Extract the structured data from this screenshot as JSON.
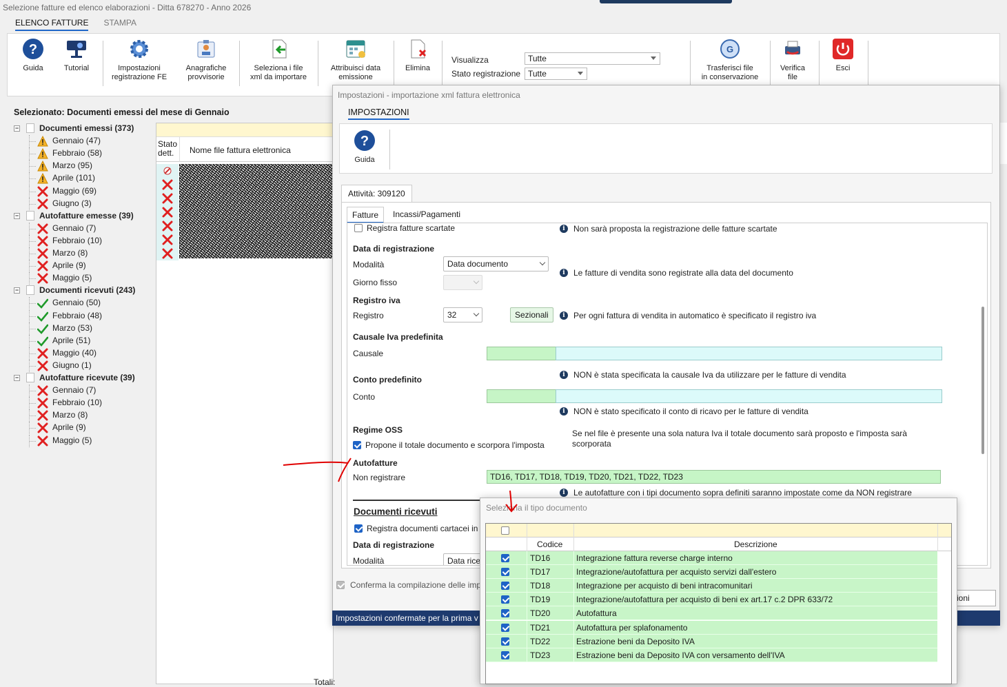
{
  "window": {
    "title": "Selezione fatture ed elenco elaborazioni - Ditta 678270 - Anno 2026"
  },
  "tabs": [
    {
      "label": "ELENCO FATTURE",
      "active": true
    },
    {
      "label": "STAMPA",
      "active": false
    }
  ],
  "ribbon": {
    "guida": "Guida",
    "tutorial": "Tutorial",
    "impostazioni_l1": "Impostazioni",
    "impostazioni_l2": "registrazione FE",
    "anagrafiche_l1": "Anagrafiche",
    "anagrafiche_l2": "provvisorie",
    "seleziona_l1": "Seleziona i file",
    "seleziona_l2": "xml da importare",
    "attribuisci_l1": "Attribuisci data",
    "attribuisci_l2": "emissione",
    "elimina": "Elimina",
    "visualizza_label": "Visualizza",
    "visualizza_value": "Tutte",
    "stato_label": "Stato registrazione",
    "stato_value": "Tutte",
    "trasferisci_l1": "Trasferisci file",
    "trasferisci_l2": "in conservazione",
    "verifica_l1": "Verifica",
    "verifica_l2": "file",
    "esci": "Esci"
  },
  "selected_header": "Selezionato: Documenti emessi del mese di Gennaio",
  "tree": [
    {
      "label": "Documenti emessi (373)",
      "root": true
    },
    {
      "label": "Gennaio (47)",
      "status": "warning"
    },
    {
      "label": "Febbraio (58)",
      "status": "warning"
    },
    {
      "label": "Marzo (95)",
      "status": "warning"
    },
    {
      "label": "Aprile (101)",
      "status": "warning"
    },
    {
      "label": "Maggio (69)",
      "status": "error"
    },
    {
      "label": "Giugno (3)",
      "status": "error"
    },
    {
      "label": "Autofatture emesse (39)",
      "root": true
    },
    {
      "label": "Gennaio (7)",
      "status": "error"
    },
    {
      "label": "Febbraio (10)",
      "status": "error"
    },
    {
      "label": "Marzo (8)",
      "status": "error"
    },
    {
      "label": "Aprile (9)",
      "status": "error"
    },
    {
      "label": "Maggio (5)",
      "status": "error"
    },
    {
      "label": "Documenti ricevuti (243)",
      "root": true
    },
    {
      "label": "Gennaio (50)",
      "status": "ok"
    },
    {
      "label": "Febbraio (48)",
      "status": "ok"
    },
    {
      "label": "Marzo (53)",
      "status": "ok"
    },
    {
      "label": "Aprile (51)",
      "status": "ok"
    },
    {
      "label": "Maggio (40)",
      "status": "error"
    },
    {
      "label": "Giugno (1)",
      "status": "error"
    },
    {
      "label": "Autofatture ricevute (39)",
      "root": true
    },
    {
      "label": "Gennaio (7)",
      "status": "error"
    },
    {
      "label": "Febbraio (10)",
      "status": "error"
    },
    {
      "label": "Marzo (8)",
      "status": "error"
    },
    {
      "label": "Aprile (9)",
      "status": "error"
    },
    {
      "label": "Maggio (5)",
      "status": "error"
    }
  ],
  "grid": {
    "col_stato_l1": "Stato",
    "col_stato_l2": "dett.",
    "col_nome": "Nome file fattura elettronica",
    "totali": "Totali:"
  },
  "dialog": {
    "title": "Impostazioni - importazione xml fattura elettronica",
    "tab": "IMPOSTAZIONI",
    "guida": "Guida",
    "attivita": "Attività: 309120",
    "inner_tabs": [
      "Fatture",
      "Incassi/Pagamenti"
    ],
    "registra_scartate": "Registra fatture scartate",
    "info_scartate": "Non sarà proposta la registrazione delle fatture scartate",
    "data_reg_header": "Data di registrazione",
    "modalita_label": "Modalità",
    "modalita_value": "Data documento",
    "info_modalita": "Le fatture di vendita sono registrate alla data del documento",
    "giorno_fisso_label": "Giorno fisso",
    "registro_iva_header": "Registro iva",
    "registro_label": "Registro",
    "registro_value": "32",
    "sezionali_button": "Sezionali",
    "info_registro": "Per ogni fattura di vendita in automatico è specificato il registro iva",
    "causale_header": "Causale Iva predefinita",
    "causale_label": "Causale",
    "info_causale": "NON è stata specificata la causale Iva da utilizzare per le fatture di vendita",
    "conto_header": "Conto predefinito",
    "conto_label": "Conto",
    "info_conto": "NON è stato specificato il conto di ricavo per le fatture di vendita",
    "oss_header": "Regime OSS",
    "oss_check": "Propone il totale documento e scorpora l'imposta",
    "info_oss_l1": "Se nel file è presente una sola natura Iva il totale documento sarà proposto e l'imposta sarà",
    "info_oss_l2": "scorporata",
    "autofatture_header": "Autofatture",
    "non_registrare_label": "Non registrare",
    "non_registrare_value": "TD16, TD17, TD18, TD19, TD20, TD21, TD22, TD23",
    "info_autofatture": "Le autofatture con i tipi documento sopra definiti saranno impostate come da NON registrare",
    "doc_ricevuti_header": "Documenti ricevuti",
    "registra_cartacei": "Registra documenti cartacei in",
    "data_reg2_header": "Data di registrazione",
    "modalita2_label": "Modalità",
    "modalita2_value": "Data rice",
    "conferma_check": "Conferma la compilazione delle imp",
    "status_bar": "Impostazioni confermate per la prima v",
    "confirm_button": "zioni"
  },
  "popup": {
    "title": "Seleziona il tipo documento",
    "col_codice": "Codice",
    "col_descrizione": "Descrizione",
    "rows": [
      {
        "codice": "TD16",
        "descrizione": "Integrazione fattura reverse charge interno",
        "checked": true
      },
      {
        "codice": "TD17",
        "descrizione": "Integrazione/autofattura per acquisto servizi dall'estero",
        "checked": true
      },
      {
        "codice": "TD18",
        "descrizione": "Integrazione per acquisto di beni intracomunitari",
        "checked": true
      },
      {
        "codice": "TD19",
        "descrizione": "Integrazione/autofattura per acquisto di beni ex art.17 c.2 DPR 633/72",
        "checked": true
      },
      {
        "codice": "TD20",
        "descrizione": "Autofattura",
        "checked": true
      },
      {
        "codice": "TD21",
        "descrizione": "Autofattura per splafonamento",
        "checked": true
      },
      {
        "codice": "TD22",
        "descrizione": "Estrazione beni da Deposito IVA",
        "checked": true
      },
      {
        "codice": "TD23",
        "descrizione": "Estrazione beni da Deposito IVA con versamento dell'IVA",
        "checked": true
      }
    ]
  },
  "colors": {
    "accent": "#1e66c8",
    "green_fill": "#c8f5c8",
    "error": "#e02020",
    "ok": "#1f9a2a",
    "warning": "#e8a000",
    "annotation": "#e00000"
  }
}
